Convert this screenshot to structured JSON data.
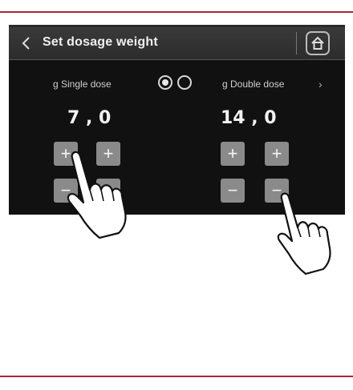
{
  "header": {
    "title": "Set dosage weight"
  },
  "doses": {
    "single": {
      "label": "g Single dose",
      "value": "7 , 0"
    },
    "double": {
      "label": "g Double dose",
      "value": "14 , 0"
    }
  },
  "buttons": {
    "plus": "+",
    "minus": "−"
  },
  "nav": {
    "next": "›"
  },
  "icons": [
    "back-arrow-icon",
    "home-icon",
    "radio-selected-icon",
    "radio-unselected-icon",
    "chevron-right-icon",
    "pointing-hand-icon"
  ],
  "colors": {
    "rule": "#a52a3a",
    "screen": "#111111",
    "button": "#8a8a8a"
  }
}
